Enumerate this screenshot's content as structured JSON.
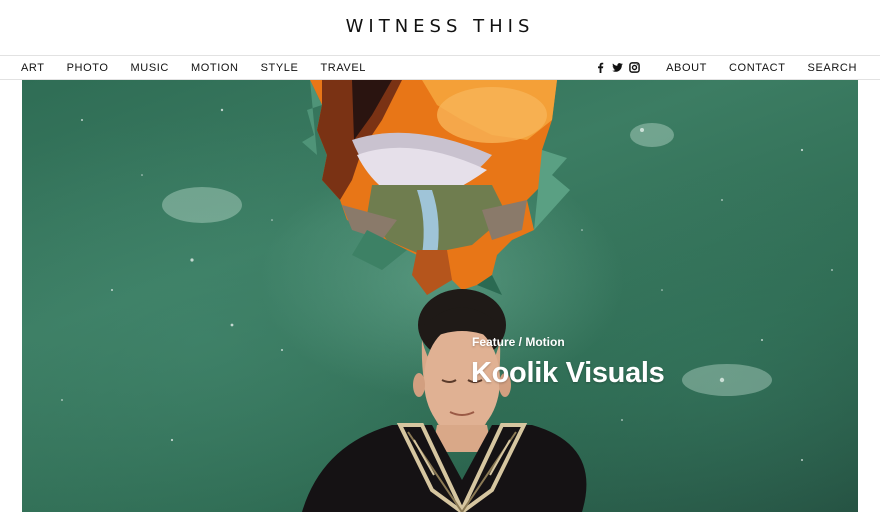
{
  "site": {
    "title": "WITNESS THIS"
  },
  "nav": {
    "left": [
      {
        "label": "ART"
      },
      {
        "label": "PHOTO"
      },
      {
        "label": "MUSIC"
      },
      {
        "label": "MOTION"
      },
      {
        "label": "STYLE"
      },
      {
        "label": "TRAVEL"
      }
    ],
    "social": [
      {
        "icon": "facebook-icon"
      },
      {
        "icon": "twitter-icon"
      },
      {
        "icon": "instagram-icon"
      }
    ],
    "right": [
      {
        "label": "ABOUT"
      },
      {
        "label": "CONTACT"
      },
      {
        "label": "SEARCH"
      }
    ]
  },
  "hero": {
    "kicker": "Feature / Motion",
    "title": "Koolik Visuals",
    "colors": {
      "background": "#2f6d55",
      "accent_orange": "#f08a1c",
      "text": "#ffffff"
    }
  }
}
